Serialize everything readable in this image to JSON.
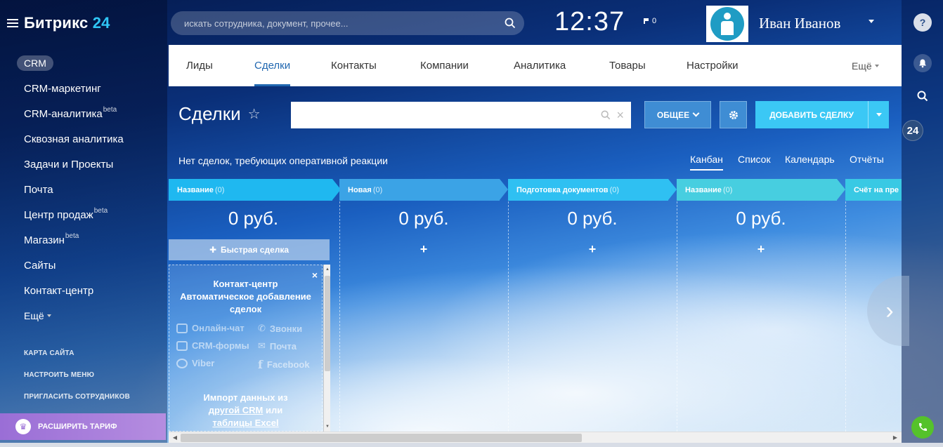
{
  "brand": {
    "name": "Битрикс",
    "num": "24"
  },
  "search": {
    "placeholder": "искать сотрудника, документ, прочее..."
  },
  "header": {
    "clock": "12:37",
    "flag_count": "0",
    "user_name": "Иван Иванов"
  },
  "sidebar": {
    "items": [
      {
        "label": "CRM",
        "sup": ""
      },
      {
        "label": "CRM-маркетинг",
        "sup": ""
      },
      {
        "label": "CRM-аналитика",
        "sup": "beta"
      },
      {
        "label": "Сквозная аналитика",
        "sup": ""
      },
      {
        "label": "Задачи и Проекты",
        "sup": ""
      },
      {
        "label": "Почта",
        "sup": ""
      },
      {
        "label": "Центр продаж",
        "sup": "beta"
      },
      {
        "label": "Магазин",
        "sup": "beta"
      },
      {
        "label": "Сайты",
        "sup": ""
      },
      {
        "label": "Контакт-центр",
        "sup": ""
      }
    ],
    "more": "Ещё",
    "links": [
      "КАРТА САЙТА",
      "НАСТРОИТЬ МЕНЮ",
      "ПРИГЛАСИТЬ СОТРУДНИКОВ"
    ],
    "upgrade": "РАСШИРИТЬ ТАРИФ"
  },
  "right_bar": {
    "help": "?",
    "counter": "24"
  },
  "nav": {
    "tabs": [
      "Лиды",
      "Сделки",
      "Контакты",
      "Компании",
      "Аналитика",
      "Товары",
      "Настройки"
    ],
    "active": "Сделки",
    "more": "Ещё"
  },
  "toolbar": {
    "title": "Сделки",
    "general": "ОБЩЕЕ",
    "add": "ДОБАВИТЬ СДЕЛКУ"
  },
  "notice": "Нет сделок, требующих оперативной реакции",
  "views": [
    "Канбан",
    "Список",
    "Календарь",
    "Отчёты"
  ],
  "kanban": {
    "columns": [
      {
        "name": "Название",
        "count": "(0)",
        "sum": "0 руб.",
        "color": "#1fb8f0"
      },
      {
        "name": "Новая",
        "count": "(0)",
        "sum": "0 руб.",
        "color": "#3ba3e6"
      },
      {
        "name": "Подготовка документов",
        "count": "(0)",
        "sum": "0 руб.",
        "color": "#2fc0f2"
      },
      {
        "name": "Название",
        "count": "(0)",
        "sum": "0 руб.",
        "color": "#47cee0"
      },
      {
        "name": "Счёт на пре",
        "count": "",
        "sum": "",
        "color": "#39c9e4"
      }
    ],
    "quick_deal": "Быстрая сделка",
    "plus": "+"
  },
  "promo": {
    "title": "Контакт-центр Автоматическое добавление сделок",
    "channels": [
      "Онлайн-чат",
      "Звонки",
      "CRM-формы",
      "Почта",
      "Viber",
      "Facebook"
    ],
    "import_text": "Импорт данных из",
    "import_link1": "другой CRM",
    "import_or": "или",
    "import_link2": "таблицы Excel"
  }
}
